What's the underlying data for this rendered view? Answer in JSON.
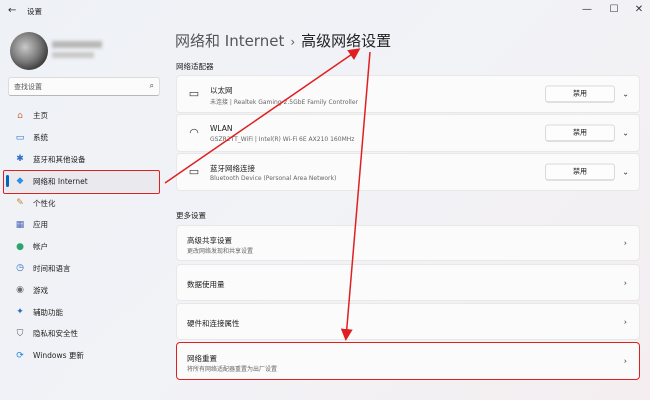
{
  "window": {
    "title": "设置",
    "back_glyph": "←",
    "minimize_glyph": "—",
    "maximize_glyph": "☐",
    "close_glyph": "✕"
  },
  "search": {
    "placeholder": "查找设置",
    "icon": "⌕"
  },
  "sidebar": {
    "items": [
      {
        "label": "主页",
        "icon": "⌂",
        "color": "#c9733b"
      },
      {
        "label": "系统",
        "icon": "▭",
        "color": "#2b6cc4"
      },
      {
        "label": "蓝牙和其他设备",
        "icon": "✱",
        "color": "#2b6cc4"
      },
      {
        "label": "网络和 Internet",
        "icon": "◆",
        "color": "#2b8ee8"
      },
      {
        "label": "个性化",
        "icon": "✎",
        "color": "#c0853a"
      },
      {
        "label": "应用",
        "icon": "▦",
        "color": "#4a66b8"
      },
      {
        "label": "帐户",
        "icon": "●",
        "color": "#2ea36b"
      },
      {
        "label": "时间和语言",
        "icon": "◷",
        "color": "#2b6cc4"
      },
      {
        "label": "游戏",
        "icon": "◉",
        "color": "#6b6b6b"
      },
      {
        "label": "辅助功能",
        "icon": "✦",
        "color": "#2b6cc4"
      },
      {
        "label": "隐私和安全性",
        "icon": "⛉",
        "color": "#555555"
      },
      {
        "label": "Windows 更新",
        "icon": "⟳",
        "color": "#1e7fd6"
      }
    ]
  },
  "breadcrumb": {
    "parent": "网络和 Internet",
    "separator": "›",
    "current": "高级网络设置"
  },
  "adapters": {
    "section_label": "网络适配器",
    "button_label": "禁用",
    "chevron": "⌄",
    "items": [
      {
        "title": "以太网",
        "subtitle": "未连接 | Realtek Gaming 2.5GbE Family Controller",
        "icon": "▭"
      },
      {
        "title": "WLAN",
        "subtitle": "GSZR2TT_WiFi | Intel(R) Wi-Fi 6E AX210 160MHz",
        "icon": "◠"
      },
      {
        "title": "蓝牙网络连接",
        "subtitle": "Bluetooth Device (Personal Area Network)",
        "icon": "▭"
      }
    ]
  },
  "more_settings": {
    "section_label": "更多设置",
    "chevron": "›",
    "items": [
      {
        "title": "高级共享设置",
        "subtitle": "更改网络发现和共享设置"
      },
      {
        "title": "数据使用量",
        "subtitle": ""
      },
      {
        "title": "硬件和连接属性",
        "subtitle": ""
      },
      {
        "title": "网络重置",
        "subtitle": "将所有网络适配器重置为出厂设置"
      }
    ]
  },
  "colors": {
    "accent": "#0067c0",
    "annotation_red": "#e02020"
  }
}
